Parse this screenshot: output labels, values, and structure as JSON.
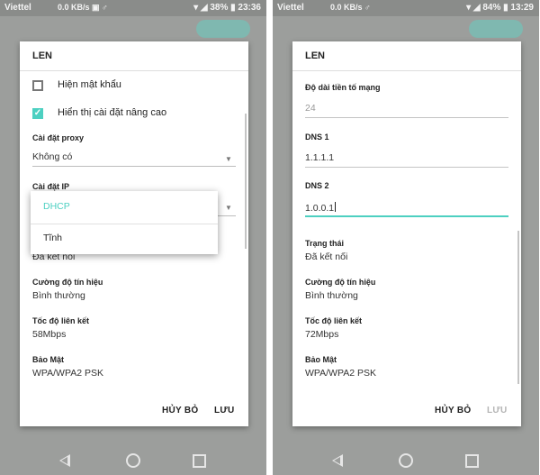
{
  "colors": {
    "accent": "#4dd0c1",
    "status_bar": "#8a8c8a",
    "dim_background": "#9c9e9c"
  },
  "left": {
    "status": {
      "carrier": "Viettel",
      "icons": "0.0 KB/s ▣ ♂",
      "wifi_signal": "▾ ◢ ",
      "battery": "38%",
      "time": "23:36"
    },
    "dialog": {
      "title": "LEN",
      "show_password": {
        "label": "Hiện mật khẩu",
        "checked": false
      },
      "show_advanced": {
        "label": "Hiển thị cài đặt nâng cao",
        "checked": true
      },
      "proxy": {
        "label": "Cài đặt proxy",
        "value": "Không có"
      },
      "ip": {
        "label": "Cài đặt IP"
      },
      "ip_options": [
        "DHCP",
        "Tĩnh"
      ],
      "ip_selected": "DHCP",
      "status_value": "Đã kết nối",
      "signal": {
        "label": "Cường độ tín hiệu",
        "value": "Bình thường"
      },
      "link_speed": {
        "label": "Tốc độ liên kết",
        "value": "58Mbps"
      },
      "security": {
        "label": "Bảo Mật",
        "value": "WPA/WPA2 PSK"
      },
      "cancel": "HỦY BỎ",
      "save": "LƯU"
    }
  },
  "right": {
    "status": {
      "carrier": "Viettel",
      "icons": "0.0 KB/s ♂",
      "wifi_signal": "▾ ◢ ",
      "battery": "84%",
      "time": "13:29"
    },
    "dialog": {
      "title": "LEN",
      "prefix": {
        "label": "Độ dài tiền tố mạng",
        "value": "24"
      },
      "dns1": {
        "label": "DNS 1",
        "value": "1.1.1.1"
      },
      "dns2": {
        "label": "DNS 2",
        "value": "1.0.0.1"
      },
      "state": {
        "label": "Trạng thái",
        "value": "Đã kết nối"
      },
      "signal": {
        "label": "Cường độ tín hiệu",
        "value": "Bình thường"
      },
      "link_speed": {
        "label": "Tốc độ liên kết",
        "value": "72Mbps"
      },
      "security": {
        "label": "Bảo Mật",
        "value": "WPA/WPA2 PSK"
      },
      "cancel": "HỦY BỎ",
      "save": "LƯU"
    }
  },
  "icons": {
    "checkbox_check": "✓",
    "dropdown_arrow": "▼"
  }
}
